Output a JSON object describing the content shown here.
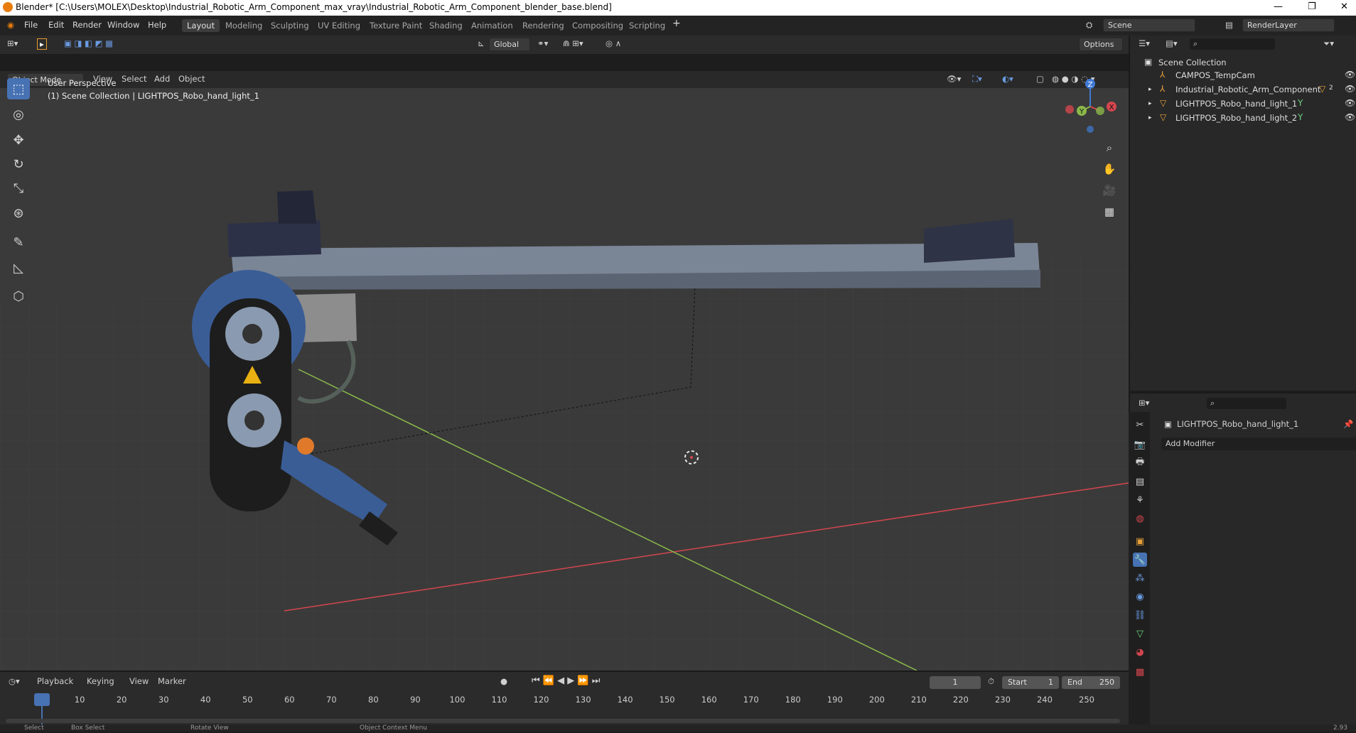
{
  "window": {
    "title": "Blender* [C:\\Users\\MOLEX\\Desktop\\Industrial_Robotic_Arm_Component_max_vray\\Industrial_Robotic_Arm_Component_blender_base.blend]",
    "minimize": "—",
    "restore": "❐",
    "close": "✕"
  },
  "menu": [
    "File",
    "Edit",
    "Render",
    "Window",
    "Help"
  ],
  "workspaces": [
    {
      "label": "Layout",
      "active": true
    },
    {
      "label": "Modeling"
    },
    {
      "label": "Sculpting"
    },
    {
      "label": "UV Editing"
    },
    {
      "label": "Texture Paint"
    },
    {
      "label": "Shading"
    },
    {
      "label": "Animation"
    },
    {
      "label": "Rendering"
    },
    {
      "label": "Compositing"
    },
    {
      "label": "Scripting"
    }
  ],
  "add_workspace": "+",
  "scene": {
    "label": "Scene",
    "render_layer": "RenderLayer"
  },
  "toolbar": {
    "orientation": "Global",
    "options": "Options"
  },
  "header": {
    "mode": "Object Mode",
    "items": [
      "View",
      "Select",
      "Add",
      "Object"
    ]
  },
  "viewport": {
    "perspective": "User Perspective",
    "collection_info": "(1) Scene Collection | LIGHTPOS_Robo_hand_light_1",
    "gizmo": {
      "z": "Z",
      "y": "Y",
      "x": "X"
    }
  },
  "outliner": {
    "root": "Scene Collection",
    "items": [
      {
        "name": "CAMPOS_TempCam",
        "icon": "empty-icon"
      },
      {
        "name": "Industrial_Robotic_Arm_Component",
        "icon": "empty-icon",
        "badge": "2"
      },
      {
        "name": "LIGHTPOS_Robo_hand_light_1",
        "icon": "mesh-icon"
      },
      {
        "name": "LIGHTPOS_Robo_hand_light_2",
        "icon": "mesh-icon"
      }
    ]
  },
  "properties": {
    "object_name": "LIGHTPOS_Robo_hand_light_1",
    "add_modifier": "Add Modifier"
  },
  "timeline": {
    "menus": [
      "Playback",
      "Keying",
      "View",
      "Marker"
    ],
    "current_frame": "1",
    "start_label": "Start",
    "start": "1",
    "end_label": "End",
    "end": "250",
    "ticks": [
      "1",
      "10",
      "20",
      "30",
      "40",
      "50",
      "60",
      "70",
      "80",
      "90",
      "100",
      "110",
      "120",
      "130",
      "140",
      "150",
      "160",
      "170",
      "180",
      "190",
      "200",
      "210",
      "220",
      "230",
      "240",
      "250"
    ]
  },
  "status": {
    "items": [
      "Select",
      "Box Select",
      "Rotate View",
      "Object Context Menu"
    ],
    "version": "2.93"
  },
  "colors": {
    "accent": "#4772b3",
    "x_axis": "#d4464e",
    "y_axis": "#8ab84a",
    "z_axis": "#3f7ad6",
    "bg": "#3a3a3a"
  }
}
